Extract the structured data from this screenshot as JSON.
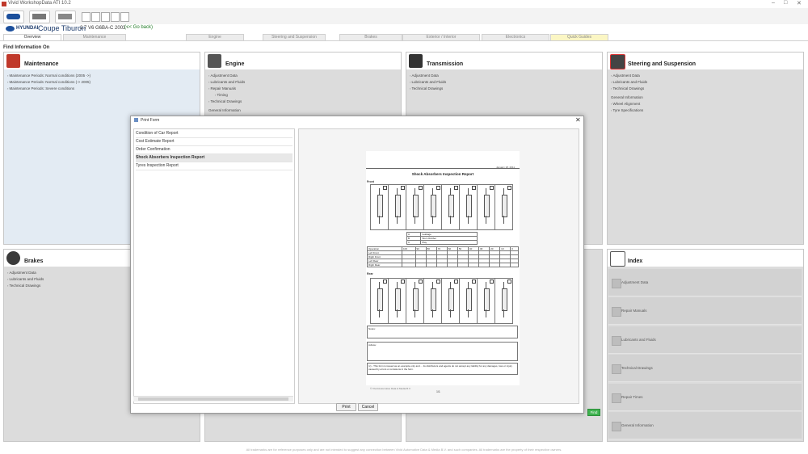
{
  "window": {
    "title": "Vivid WorkshopData ATI 10.2",
    "min": "–",
    "max": "□",
    "close": "✕"
  },
  "vehicle": {
    "brand": "HYUNDAI",
    "model": "Coupe Tiburon",
    "engine": "2.7 V6 G6BA-C 2003 -",
    "back": "(<< Go back)"
  },
  "tabs": [
    "Overview",
    "Maintenance",
    "Engine",
    "Steering and Suspension",
    "Brakes",
    "Exterior / Interior",
    "Electronics",
    "Quick Guides"
  ],
  "find_heading": "Find Information On",
  "cards": {
    "maintenance": {
      "title": "Maintenance",
      "items": [
        "Maintenance Periods: Normal conditions (2005 ->)",
        "Maintenance Periods: Normal conditions (-> 2005)",
        "Maintenance Periods: Severe conditions"
      ]
    },
    "engine": {
      "title": "Engine",
      "items": [
        "Adjustment Data",
        "Lubricants and Fluids",
        "Repair Manuals",
        "Timing",
        "Technical Drawings",
        "General Information"
      ]
    },
    "transmission": {
      "title": "Transmission",
      "items": [
        "Adjustment Data",
        "Lubricants and Fluids",
        "Technical Drawings"
      ]
    },
    "steering": {
      "title": "Steering and Suspension",
      "items": [
        "Adjustment Data",
        "Lubricants and Fluids",
        "Technical Drawings",
        "General Information",
        "Wheel Alignment",
        "Tyre Specifications"
      ]
    },
    "brakes": {
      "title": "Brakes",
      "items": [
        "Adjustment Data",
        "Lubricants and Fluids",
        "Technical Drawings"
      ]
    },
    "index": {
      "title": "Index",
      "items": [
        "Adjustment Data",
        "Repair Manuals",
        "Lubricants and Fluids",
        "Technical Drawings",
        "Repair Times",
        "General Information"
      ]
    }
  },
  "find_button": "Find",
  "footer": "All trademarks are for reference purposes only and are not intended to suggest any connection between Vivid Automotive Data & Media B.V. and such companies. All trademarks are the property of their respective owners.",
  "dialog": {
    "title": "Print Form",
    "close": "✕",
    "forms": [
      "Condition of Car Report",
      "Cost Estimate Report",
      "Order Confirmation",
      "Shock Absorbers Inspection Report",
      "Tyres Inspection Report"
    ],
    "selected_index": 3,
    "print": "Print",
    "cancel": "Cancel"
  },
  "report": {
    "date": "January 18, 2011",
    "title": "Shock Absorbers Inspection Report",
    "front": "Front",
    "rear": "Rear",
    "legend": [
      [
        "A",
        "Leakage"
      ],
      [
        "B",
        "Worn Rubber"
      ],
      [
        "C",
        "Play"
      ]
    ],
    "op_header": [
      "Operation",
      "100",
      "90",
      "80",
      "70",
      "60",
      "50",
      "40",
      "30",
      "20",
      "10",
      "0"
    ],
    "op_rows": [
      "Left Front",
      "Right Front",
      "Left Rear",
      "Right Rear"
    ],
    "notes": "Notes:",
    "advice": "Advice:",
    "disclaimer": "(c) - This form is issued as an example only and ... its distributors and agents do not accept any liability for any damages, loss or injury caused by errors or omissions in the form.",
    "footer": "© Vivid Automotive Data & Media B.V.",
    "page": "1/1"
  }
}
